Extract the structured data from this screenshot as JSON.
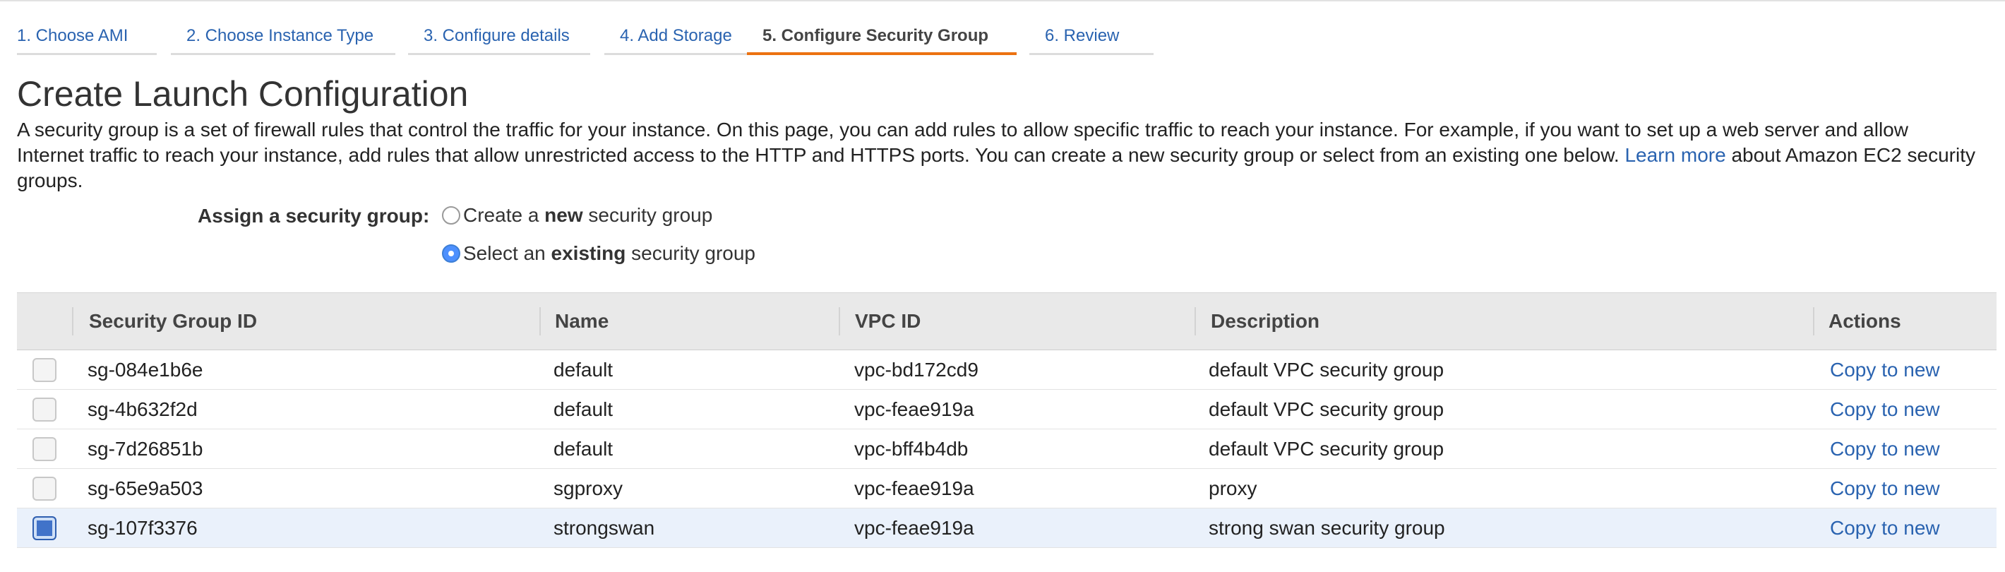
{
  "wizard": {
    "tabs": [
      {
        "label": "1. Choose AMI"
      },
      {
        "label": "2. Choose Instance Type"
      },
      {
        "label": "3. Configure details"
      },
      {
        "label": "4. Add Storage"
      },
      {
        "label": "5. Configure Security Group"
      },
      {
        "label": "6. Review"
      }
    ],
    "active_tab_index": 4
  },
  "page": {
    "title": "Create Launch Configuration",
    "description_pre": "A security group is a set of firewall rules that control the traffic for your instance. On this page, you can add rules to allow specific traffic to reach your instance. For example, if you want to set up a web server and allow Internet traffic to reach your instance, add rules that allow unrestricted access to the HTTP and HTTPS ports. You can create a new security group or select from an existing one below. ",
    "learn_more": "Learn more",
    "description_post": " about Amazon EC2 security groups."
  },
  "assign": {
    "label": "Assign a security group:",
    "options": [
      {
        "pre": "Create a ",
        "bold": "new",
        "post": " security group",
        "checked": false
      },
      {
        "pre": "Select an ",
        "bold": "existing",
        "post": " security group",
        "checked": true
      }
    ]
  },
  "table": {
    "columns": [
      "Security Group ID",
      "Name",
      "VPC ID",
      "Description",
      "Actions"
    ],
    "rows": [
      {
        "id": "sg-084e1b6e",
        "name": "default",
        "vpc": "vpc-bd172cd9",
        "description": "default VPC security group",
        "action": "Copy to new",
        "checked": false
      },
      {
        "id": "sg-4b632f2d",
        "name": "default",
        "vpc": "vpc-feae919a",
        "description": "default VPC security group",
        "action": "Copy to new",
        "checked": false
      },
      {
        "id": "sg-7d26851b",
        "name": "default",
        "vpc": "vpc-bff4b4db",
        "description": "default VPC security group",
        "action": "Copy to new",
        "checked": false
      },
      {
        "id": "sg-65e9a503",
        "name": "sgproxy",
        "vpc": "vpc-feae919a",
        "description": "proxy",
        "action": "Copy to new",
        "checked": false
      },
      {
        "id": "sg-107f3376",
        "name": "strongswan",
        "vpc": "vpc-feae919a",
        "description": "strong swan security group",
        "action": "Copy to new",
        "checked": true
      }
    ]
  },
  "colors": {
    "link": "#2a63b0",
    "active_tab_underline": "#ec7211",
    "header_bg": "#e9e9e9",
    "selected_row_bg": "#eaf1fb"
  }
}
